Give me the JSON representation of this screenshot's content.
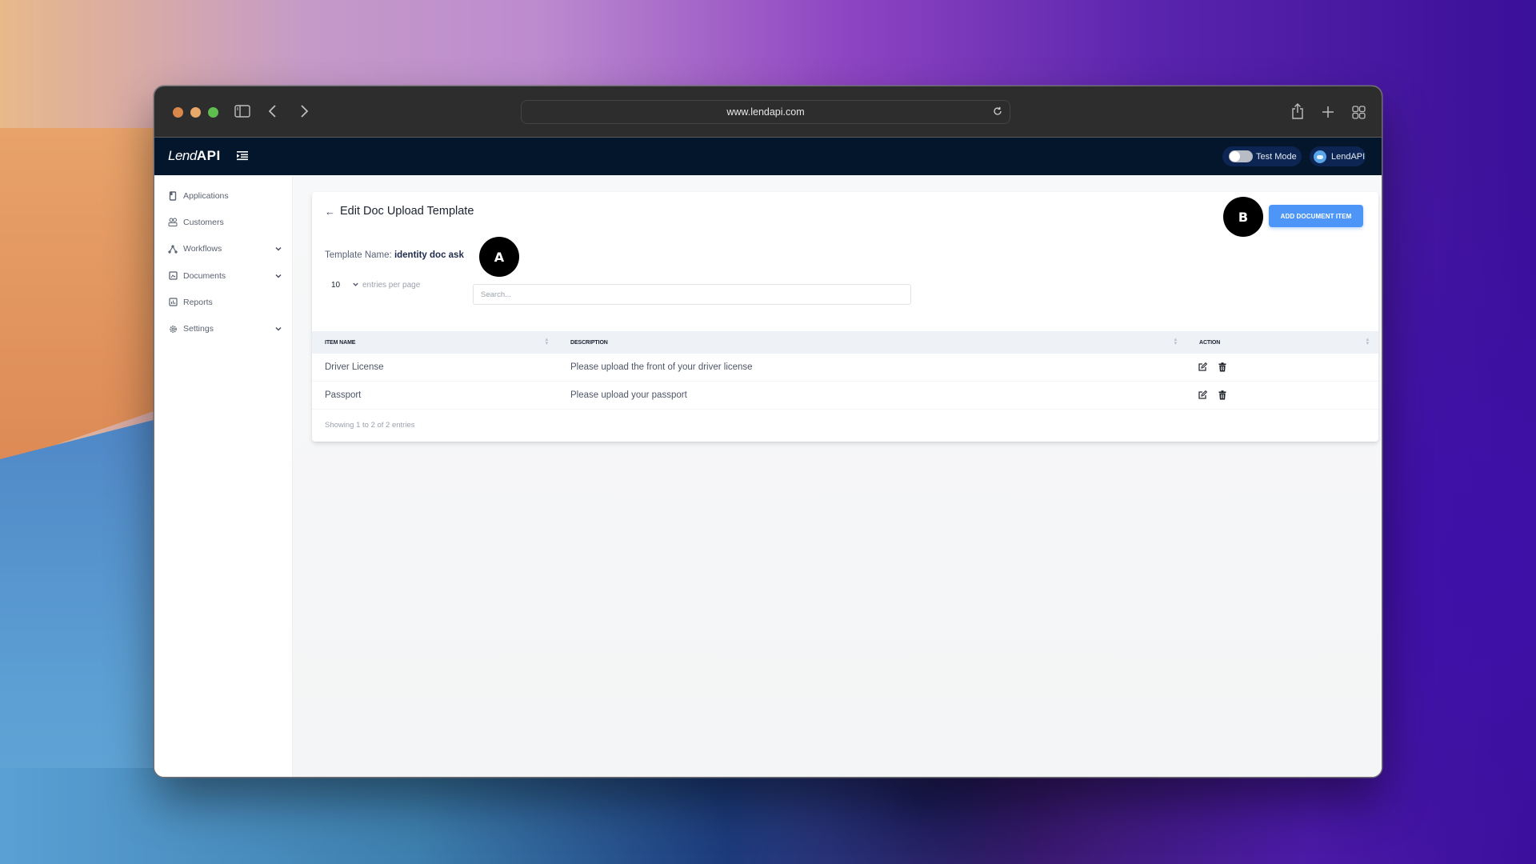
{
  "browser": {
    "url": "www.lendapi.com",
    "traffic_colors": {
      "close": "#d9874a",
      "minimize": "#e8a86a",
      "maximize": "#5fbe4f"
    }
  },
  "appbar": {
    "logo_light": "Lend",
    "logo_bold": "API",
    "test_mode_label": "Test Mode",
    "test_mode_on": false,
    "user_label": "LendAPI"
  },
  "sidebar": {
    "items": [
      {
        "label": "Applications",
        "icon": "clipboard-icon",
        "has_submenu": false
      },
      {
        "label": "Customers",
        "icon": "users-icon",
        "has_submenu": false
      },
      {
        "label": "Workflows",
        "icon": "workflow-icon",
        "has_submenu": true
      },
      {
        "label": "Documents",
        "icon": "document-icon",
        "has_submenu": true
      },
      {
        "label": "Reports",
        "icon": "chart-icon",
        "has_submenu": false
      },
      {
        "label": "Settings",
        "icon": "gear-icon",
        "has_submenu": true
      }
    ]
  },
  "page": {
    "back_arrow": "←",
    "title": "Edit Doc Upload Template",
    "template_name_label": "Template Name:",
    "template_name_value": "identity doc ask",
    "add_button_label": "ADD DOCUMENT ITEM",
    "marker_a": "A",
    "marker_b": "B",
    "accent_color": "#4d96f7"
  },
  "table_controls": {
    "entries_per_page": "10",
    "entries_label": "entries per page",
    "search_placeholder": "Search..."
  },
  "table": {
    "columns": [
      "ITEM NAME",
      "DESCRIPTION",
      "ACTION"
    ],
    "rows": [
      {
        "item_name": "Driver License",
        "description": "Please upload the front of your driver license"
      },
      {
        "item_name": "Passport",
        "description": "Please upload your passport"
      }
    ],
    "footer": "Showing 1 to 2 of 2 entries"
  }
}
